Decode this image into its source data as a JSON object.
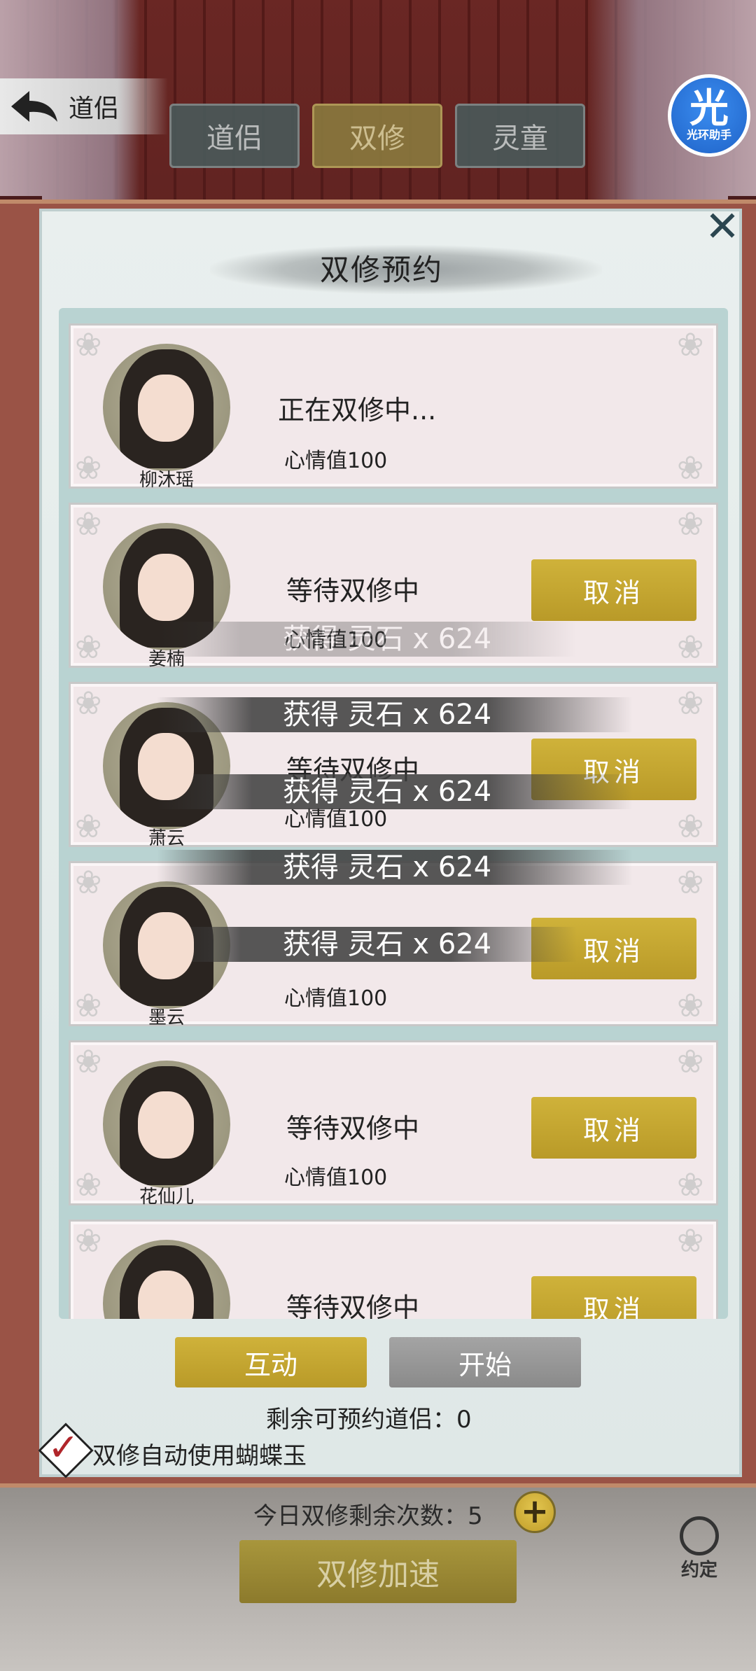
{
  "header": {
    "back_label": "道侣",
    "tabs": [
      {
        "label": "道侣",
        "active": false
      },
      {
        "label": "双修",
        "active": true
      },
      {
        "label": "灵童",
        "active": false
      }
    ],
    "helper": {
      "big": "光",
      "small": "光环助手"
    }
  },
  "dialog": {
    "title": "双修预约",
    "close_glyph": "✕",
    "cards": [
      {
        "name": "柳沐瑶",
        "status": "正在双修中...",
        "mood": "心情值100",
        "cancel": ""
      },
      {
        "name": "姜楠",
        "status": "等待双修中",
        "mood": "心情值100",
        "cancel": "取消"
      },
      {
        "name": "萧云",
        "status": "等待双修中",
        "mood": "心情值100",
        "cancel": "取消"
      },
      {
        "name": "墨云",
        "status": "",
        "mood": "心情值100",
        "cancel": "取消"
      },
      {
        "name": "花仙儿",
        "status": "等待双修中",
        "mood": "心情值100",
        "cancel": "取消"
      },
      {
        "name": "",
        "status": "等待双修中",
        "mood": "",
        "cancel": "取消"
      }
    ],
    "toasts": [
      "获得 灵石 x 624",
      "获得 灵石 x 624",
      "获得 灵石 x 624",
      "获得 灵石 x 624",
      "获得 灵石 x 624"
    ],
    "interact_label": "互动",
    "start_label": "开始",
    "remaining_label": "剩余可预约道侣：0",
    "auto_use_label": "双修自动使用蝴蝶玉"
  },
  "footer": {
    "today_label": "今日双修剩余次数：5",
    "plus": "+",
    "speed_label": "双修加速",
    "appoint_label": "约定"
  },
  "colors": {
    "gold": "#c4a631",
    "cancel_text": "#ffffff",
    "frame": "#9a5346"
  }
}
